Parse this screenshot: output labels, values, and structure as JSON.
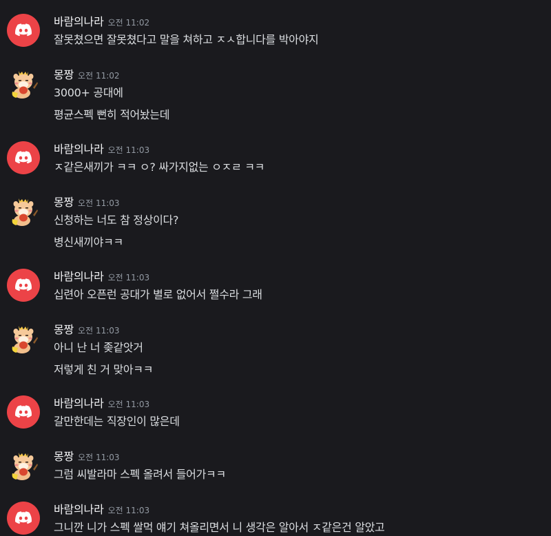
{
  "messages": [
    {
      "author": "바람의나라",
      "avatar": "discord-avatar",
      "time": "오전 11:02",
      "lines": [
        "잘못쳤으면 잘못쳤다고 말을 쳐하고 ㅈㅅ합니다를 박아야지"
      ]
    },
    {
      "author": "몽짱",
      "avatar": "hamster-avatar",
      "time": "오전 11:02",
      "lines": [
        "3000+ 공대에",
        "평균스펙 뻔히 적어놨는데"
      ]
    },
    {
      "author": "바람의나라",
      "avatar": "discord-avatar",
      "time": "오전 11:03",
      "lines": [
        "ㅈ같은새끼가 ㅋㅋ ㅇ? 싸가지없는 ㅇㅈㄹ ㅋㅋ"
      ]
    },
    {
      "author": "몽짱",
      "avatar": "hamster-avatar",
      "time": "오전 11:03",
      "lines": [
        "신청하는 너도 참 정상이다?",
        "병신새끼야ㅋㅋ"
      ]
    },
    {
      "author": "바람의나라",
      "avatar": "discord-avatar",
      "time": "오전 11:03",
      "lines": [
        "십련아 오픈런 공대가 별로 없어서 쩔수라 그래"
      ]
    },
    {
      "author": "몽짱",
      "avatar": "hamster-avatar",
      "time": "오전 11:03",
      "lines": [
        "아니 난 너 좆같앗거",
        "저렇게 친 거 맞아ㅋㅋ"
      ]
    },
    {
      "author": "바람의나라",
      "avatar": "discord-avatar",
      "time": "오전 11:03",
      "lines": [
        "갈만한데는 직장인이 많은데"
      ]
    },
    {
      "author": "몽짱",
      "avatar": "hamster-avatar",
      "time": "오전 11:03",
      "lines": [
        "그럼 씨발라마 스펙 올려서 들어가ㅋㅋ"
      ]
    },
    {
      "author": "바람의나라",
      "avatar": "discord-avatar",
      "time": "오전 11:03",
      "lines": [
        "그니깐 니가 스펙 쌀먹 얘기 쳐올리면서 니 생각은 알아서 ㅈ같은건 알았고"
      ]
    }
  ]
}
